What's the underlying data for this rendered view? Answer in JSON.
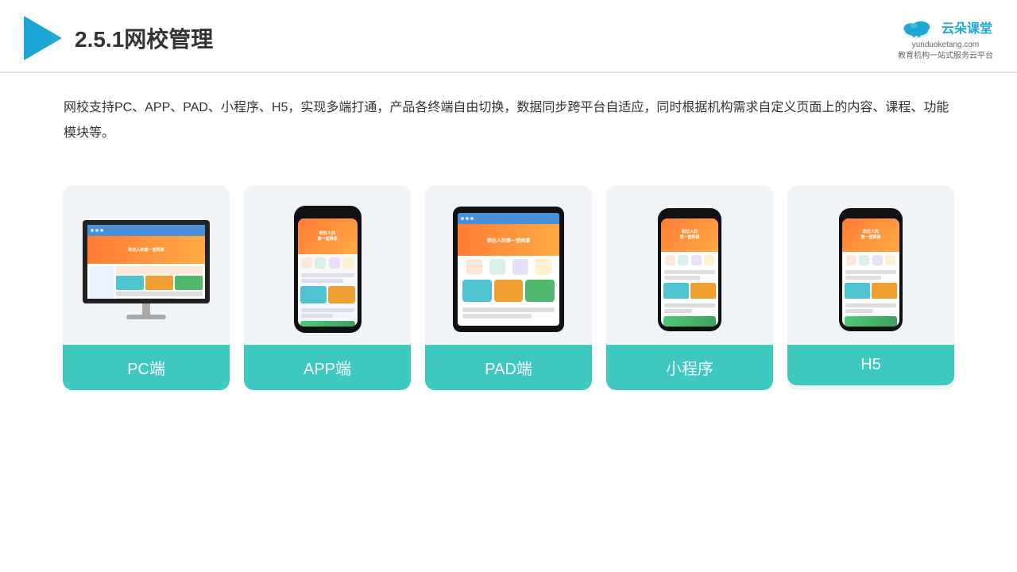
{
  "header": {
    "title": "2.5.1网校管理",
    "logo_name": "云朵课堂",
    "logo_url": "yunduoketang.com",
    "logo_subtitle_line1": "教育机构一站",
    "logo_subtitle_line2": "式服务云平台"
  },
  "description": {
    "text": "网校支持PC、APP、PAD、小程序、H5，实现多端打通，产品各终端自由切换，数据同步跨平台自适应，同时根据机构需求自定义页面上的内容、课程、功能模块等。"
  },
  "cards": [
    {
      "label": "PC端",
      "type": "pc"
    },
    {
      "label": "APP端",
      "type": "phone"
    },
    {
      "label": "PAD端",
      "type": "pad"
    },
    {
      "label": "小程序",
      "type": "phone-mini"
    },
    {
      "label": "H5",
      "type": "phone-mini"
    }
  ]
}
